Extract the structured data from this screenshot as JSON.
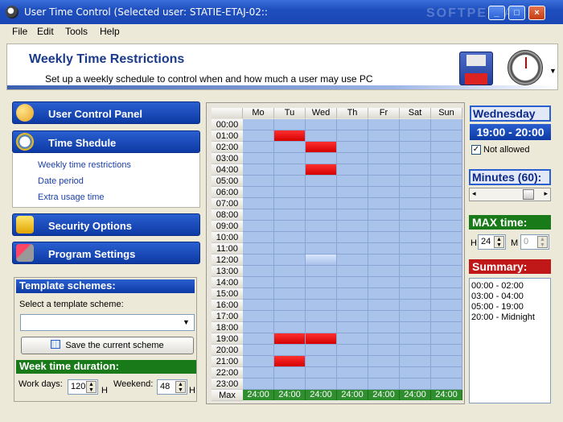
{
  "window": {
    "title": "User Time Control (Selected user: STATIE-ETAJ-02::",
    "watermark": "SOFTPEDIA",
    "minimize": "_",
    "maximize": "□",
    "close": "×"
  },
  "menu": [
    "File",
    "Edit",
    "Tools",
    "Help"
  ],
  "header": {
    "title": "Weekly Time Restrictions",
    "subtitle": "Set up a weekly schedule to control when and how much a user may use  PC"
  },
  "sidebar": {
    "user_control": "User Control Panel",
    "time_schedule": "Time Shedule",
    "links": [
      "Weekly time restrictions",
      "Date period",
      "Extra usage time"
    ],
    "security": "Security Options",
    "program": "Program Settings"
  },
  "templates": {
    "title": "Template schemes:",
    "select_label": "Select a template scheme:",
    "selected": "",
    "save_button": "Save the current scheme"
  },
  "week_duration": {
    "title": "Week time duration:",
    "workdays_label": "Work days:",
    "workdays_value": "120",
    "workdays_unit": "H",
    "weekend_label": "Weekend:",
    "weekend_value": "48",
    "weekend_unit": "H"
  },
  "schedule": {
    "days": [
      "Mo",
      "Tu",
      "Wed",
      "Th",
      "Fr",
      "Sat",
      "Sun"
    ],
    "hours": [
      "00:00",
      "01:00",
      "02:00",
      "03:00",
      "04:00",
      "05:00",
      "06:00",
      "07:00",
      "08:00",
      "09:00",
      "10:00",
      "11:00",
      "12:00",
      "13:00",
      "14:00",
      "15:00",
      "16:00",
      "17:00",
      "18:00",
      "19:00",
      "20:00",
      "21:00",
      "22:00",
      "23:00"
    ],
    "blocked": [
      [
        1,
        1
      ],
      [
        2,
        2
      ],
      [
        4,
        2
      ],
      [
        19,
        1
      ],
      [
        19,
        2
      ],
      [
        21,
        1
      ]
    ],
    "highlight": [
      12,
      2
    ],
    "max_label": "Max",
    "max_values": [
      "24:00",
      "24:00",
      "24:00",
      "24:00",
      "24:00",
      "24:00",
      "24:00"
    ]
  },
  "right_panel": {
    "day": "Wednesday",
    "time_range": "19:00 - 20:00",
    "not_allowed_label": "Not allowed",
    "not_allowed_checked": true,
    "minutes_title": "Minutes (60):",
    "minutes_value": 60,
    "max_time_title": "MAX time:",
    "max_h_label": "H",
    "max_h_value": "24",
    "max_m_label": "M",
    "max_m_value": "0",
    "summary_title": "Summary:",
    "summary": [
      "00:00 - 02:00",
      "03:00 - 04:00",
      "05:00 - 19:00",
      "20:00 - Midnight"
    ]
  },
  "colors": {
    "blocked": "#e01010",
    "allowed": "#aac3ea",
    "max_row": "#2f8f2f"
  }
}
